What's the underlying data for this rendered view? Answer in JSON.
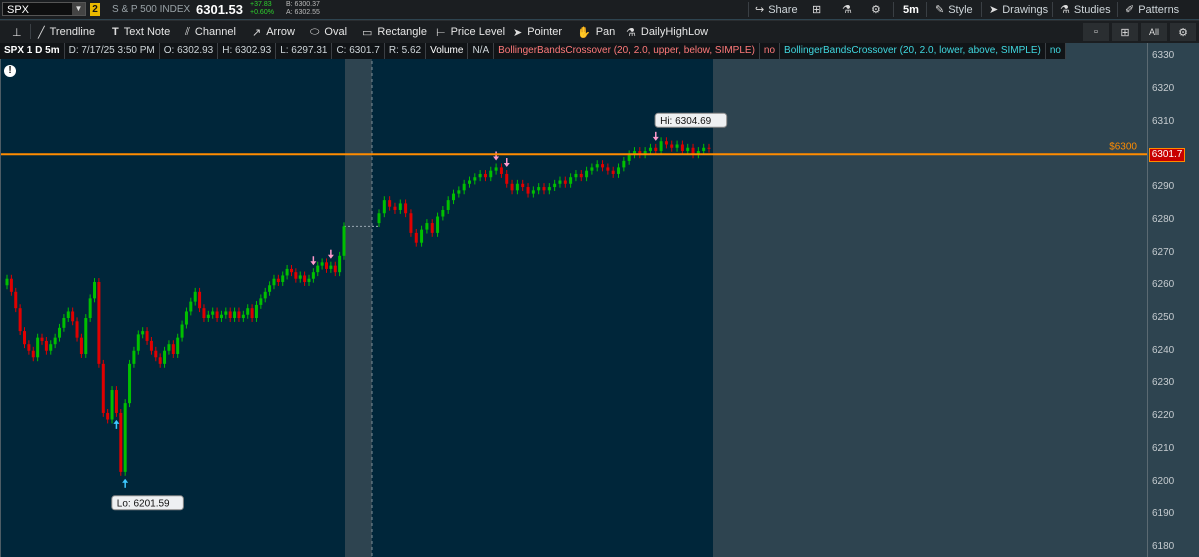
{
  "header": {
    "symbol": "SPX",
    "link_badge": "2",
    "description": "S & P 500 INDEX",
    "last_price": "6301.53",
    "net_change": "+37.83",
    "pct_change": "+0.60%",
    "bid": "B: 6300.37",
    "ask": "A: 6302.55",
    "right_buttons": [
      "Share",
      "5m",
      "Style",
      "Drawings",
      "Studies",
      "Patterns"
    ]
  },
  "toolbar": {
    "tools": [
      "Trendline",
      "Text Note",
      "Channel",
      "Arrow",
      "Oval",
      "Rectangle",
      "Price Level",
      "Pointer",
      "Pan",
      "DailyHighLow"
    ]
  },
  "infobar": {
    "title": "SPX 1 D 5m",
    "date": "D: 7/17/25 3:50 PM",
    "open": "O: 6302.93",
    "high": "H: 6302.93",
    "low": "L: 6297.31",
    "close": "C: 6301.7",
    "range": "R: 5.62",
    "volume_label": "Volume",
    "volume_value": "N/A",
    "study1": "BollingerBandsCrossover (20, 2.0, upper, below, SIMPLE)",
    "study1_value": "no",
    "study2": "BollingerBandsCrossover (20, 2.0, lower, above, SIMPLE)",
    "study2_value": "no"
  },
  "colors": {
    "up": "#00c000",
    "down": "#e00000",
    "price_line": "#ff8c00",
    "session_bg": "#00263a",
    "off_bg": "#2e4450",
    "sell_arrow": "#ff99cc",
    "buy_arrow": "#3ec8ff"
  },
  "chart_data": {
    "type": "candlestick",
    "y_ticks": [
      6330,
      6320,
      6310,
      6300,
      6290,
      6280,
      6270,
      6260,
      6250,
      6240,
      6230,
      6220,
      6210,
      6200,
      6190,
      6180
    ],
    "ylim": [
      6177,
      6334
    ],
    "price_level_label": "$6300",
    "price_level": 6300,
    "last_price_label": "6301.7",
    "last_price": 6301.7,
    "hi_label": "Hi: 6304.69",
    "hi": 6304.69,
    "lo_label": "Lo: 6201.59",
    "lo": 6201.59,
    "closes": [
      6262,
      6258,
      6253,
      6246,
      6242,
      6240,
      6238,
      6244,
      6243,
      6240,
      6242,
      6244,
      6247,
      6250,
      6252,
      6249,
      6244,
      6239,
      6250,
      6256,
      6261,
      6236,
      6221,
      6219,
      6228,
      6221,
      6203,
      6224,
      6236,
      6240,
      6245,
      6246,
      6243,
      6240,
      6238,
      6236,
      6240,
      6242,
      6239,
      6244,
      6248,
      6252,
      6255,
      6258,
      6253,
      6250,
      6251,
      6252,
      6250,
      6251,
      6252,
      6250,
      6252,
      6250,
      6251,
      6253,
      6250,
      6254,
      6256,
      6258,
      6260,
      6262,
      6261,
      6263,
      6265,
      6264,
      6262,
      6263,
      6261,
      6262,
      6264,
      6266,
      6267,
      6265,
      6266,
      6264,
      6269,
      6278,
      6282,
      6286,
      6284,
      6283,
      6285,
      6282,
      6276,
      6273,
      6277,
      6279,
      6276,
      6281,
      6283,
      6286,
      6288,
      6289,
      6291,
      6292,
      6293,
      6294,
      6293,
      6295,
      6296,
      6294,
      6291,
      6289,
      6291,
      6290,
      6288,
      6289,
      6290,
      6289,
      6290,
      6291,
      6292,
      6291,
      6293,
      6294,
      6293,
      6295,
      6296,
      6297,
      6296,
      6295,
      6294,
      6296,
      6298,
      6300,
      6301,
      6300,
      6301,
      6302,
      6301,
      6304,
      6303,
      6302,
      6303,
      6301,
      6302,
      6300,
      6301,
      6302,
      6301.7
    ],
    "sell_signal_indices": [
      70,
      74,
      100,
      102,
      130
    ],
    "buy_signal_indices": [
      25,
      27
    ]
  }
}
